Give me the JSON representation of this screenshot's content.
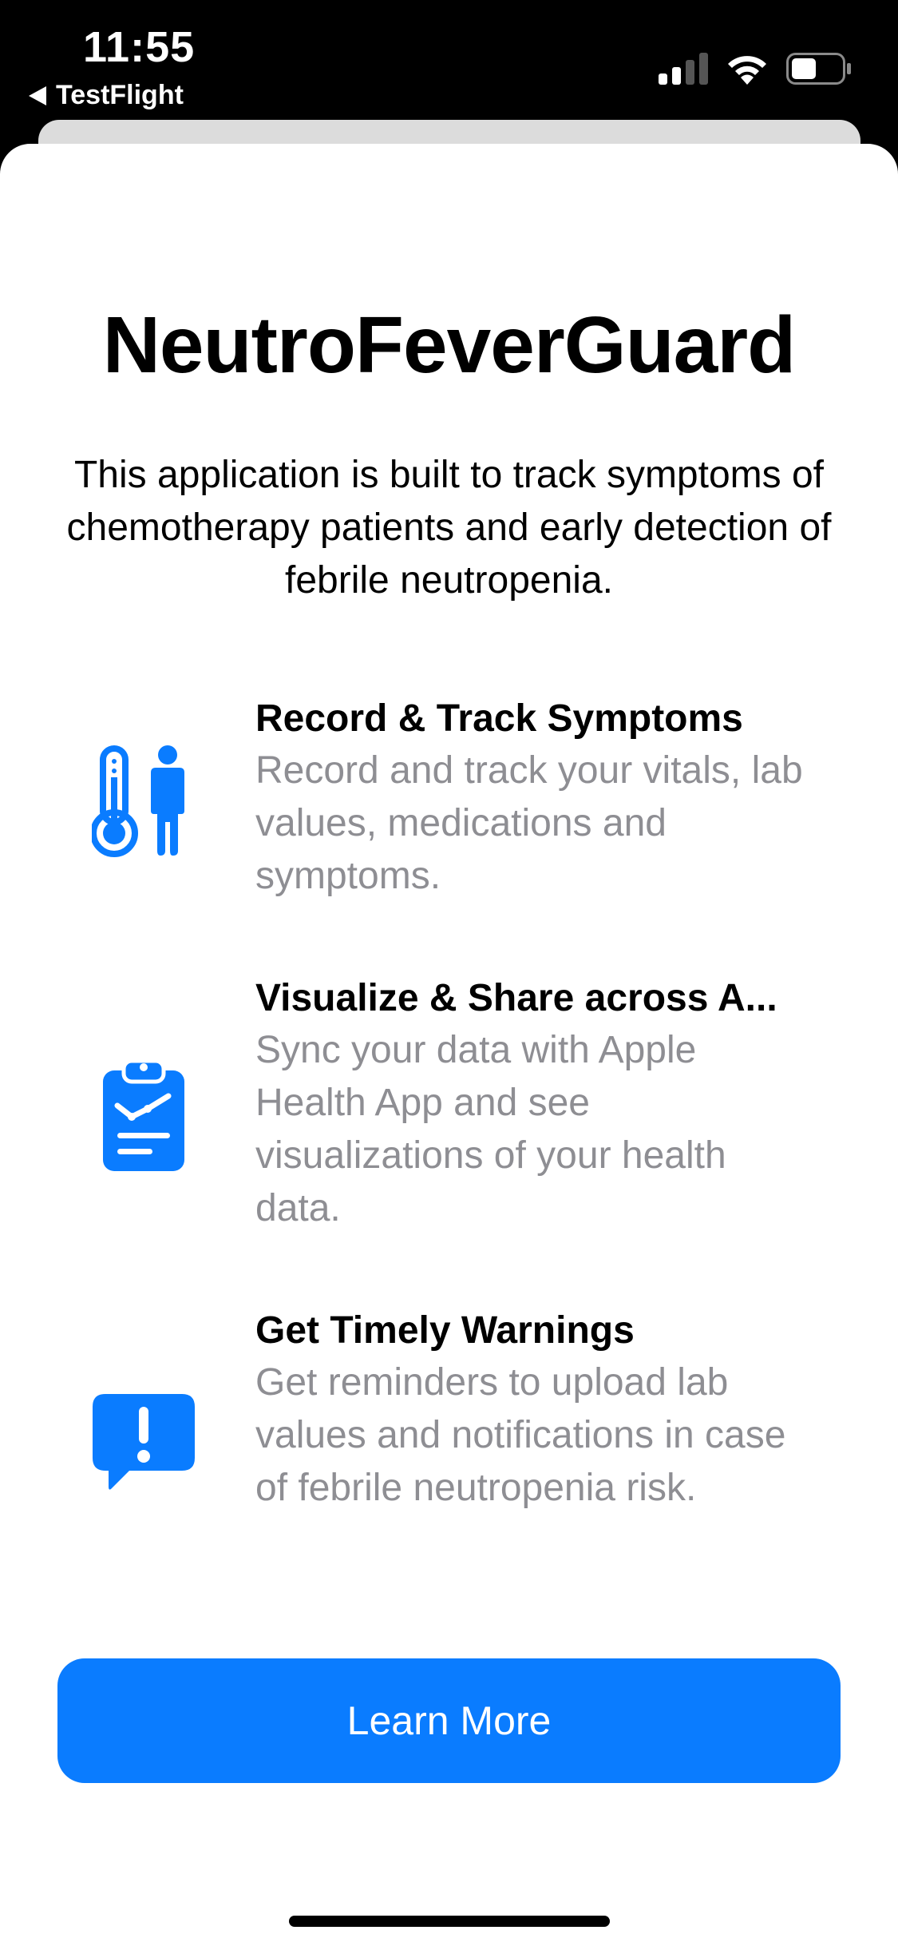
{
  "status_bar": {
    "time": "11:55",
    "back_label": "TestFlight"
  },
  "app": {
    "title": "NeutroFeverGuard",
    "subtitle": "This application is built to track symptoms of chemotherapy patients and early detection of febrile neutropenia."
  },
  "features": [
    {
      "icon": "thermometer-person-icon",
      "title": "Record & Track Symptoms",
      "description": "Record and track your vitals, lab values, medications and symptoms."
    },
    {
      "icon": "clipboard-chart-icon",
      "title": "Visualize & Share across A...",
      "description": "Sync your data with Apple Health App and see visualizations of your health data."
    },
    {
      "icon": "exclamation-bubble-icon",
      "title": "Get Timely Warnings",
      "description": "Get reminders to upload lab values and notifications in case of febrile neutropenia risk."
    }
  ],
  "actions": {
    "learn_more_label": "Learn More"
  },
  "colors": {
    "accent": "#0A7CFF",
    "secondary_text": "#8E8E93"
  }
}
